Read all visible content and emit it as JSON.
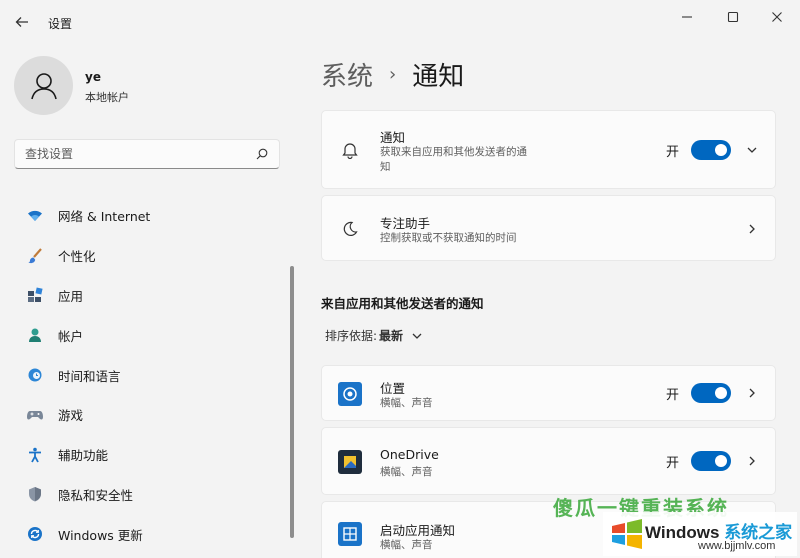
{
  "window": {
    "title": "设置"
  },
  "user": {
    "name": "ye",
    "account_type": "本地帐户"
  },
  "search": {
    "placeholder": "查找设置"
  },
  "sidebar": {
    "items": [
      {
        "label": "网络 & Internet",
        "icon": "wifi-icon"
      },
      {
        "label": "个性化",
        "icon": "brush-icon"
      },
      {
        "label": "应用",
        "icon": "apps-icon"
      },
      {
        "label": "帐户",
        "icon": "person-icon"
      },
      {
        "label": "时间和语言",
        "icon": "globe-clock-icon"
      },
      {
        "label": "游戏",
        "icon": "gamepad-icon"
      },
      {
        "label": "辅助功能",
        "icon": "accessibility-icon"
      },
      {
        "label": "隐私和安全性",
        "icon": "shield-icon"
      },
      {
        "label": "Windows 更新",
        "icon": "update-icon"
      }
    ]
  },
  "breadcrumb": {
    "parent": "系统",
    "separator": "›",
    "current": "通知"
  },
  "notifications_card": {
    "title": "通知",
    "subtitle_line1": "获取来自应用和其他发送者的通",
    "subtitle_line2": "知",
    "toggle_label": "开",
    "toggle_on": true
  },
  "focus_card": {
    "title": "专注助手",
    "subtitle": "控制获取或不获取通知的时间"
  },
  "section": {
    "title": "来自应用和其他发送者的通知",
    "sort_label": "排序依据:",
    "sort_value": "最新"
  },
  "apps": [
    {
      "name": "位置",
      "detail": "横幅、声音",
      "toggle_label": "开",
      "toggle_on": true,
      "icon": "location-icon"
    },
    {
      "name": "OneDrive",
      "detail": "横幅、声音",
      "toggle_label": "开",
      "toggle_on": true,
      "icon": "onedrive-icon"
    },
    {
      "name": "启动应用通知",
      "detail": "横幅、声音",
      "icon": "startup-apps-icon"
    }
  ],
  "watermark": {
    "top_text": "傻瓜一键重装系统",
    "title_part1": "Windows ",
    "title_part2": "系统之家",
    "url": "www.bjjmlv.com"
  },
  "colors": {
    "accent": "#0067c0",
    "background": "#f3f3f3",
    "card": "#fbfbfb"
  }
}
